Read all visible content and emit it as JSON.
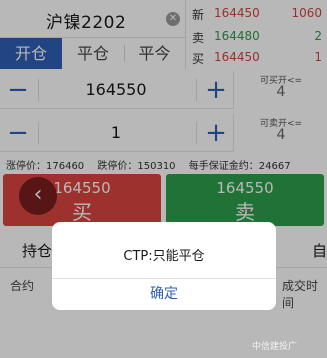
{
  "symbol": {
    "name": "沪镍2202"
  },
  "order_book": [
    {
      "label": "新",
      "price": "164450",
      "volume": "1060",
      "price_color": "#d64541",
      "volume_color": "#d64541"
    },
    {
      "label": "卖",
      "price": "164480",
      "volume": "2",
      "price_color": "#2e9b4a",
      "volume_color": "#2e9b4a"
    },
    {
      "label": "买",
      "price": "164450",
      "volume": "1",
      "price_color": "#d64541",
      "volume_color": "#d64541"
    }
  ],
  "tabs": [
    {
      "label": "开仓",
      "active": true
    },
    {
      "label": "平仓",
      "active": false
    },
    {
      "label": "平今",
      "active": false
    }
  ],
  "price_stepper": {
    "value": "164550",
    "minus": "−",
    "plus": "+"
  },
  "qty_stepper": {
    "value": "1",
    "minus": "−",
    "plus": "+"
  },
  "available_open": {
    "title": "可买开<=",
    "value": "4"
  },
  "available_sell": {
    "title": "可卖开<=",
    "value": "4"
  },
  "limits": {
    "limit_up": "涨停价：176460",
    "limit_down": "跌停价：150310",
    "margin": "每手保证金约：24667"
  },
  "buy": {
    "price": "164550",
    "action": "买"
  },
  "sell": {
    "price": "164550",
    "action": "卖"
  },
  "lower": {
    "tab_left": "持仓",
    "tab_right": "自",
    "col_left": "合约",
    "col_right": "成交时间"
  },
  "dialog": {
    "message": "CTP:只能平仓",
    "confirm": "确定"
  },
  "watermark": "中信建投广",
  "colors": {
    "accent": "#2f5fb5",
    "buy": "#d94541",
    "sell": "#2f9e4c"
  }
}
